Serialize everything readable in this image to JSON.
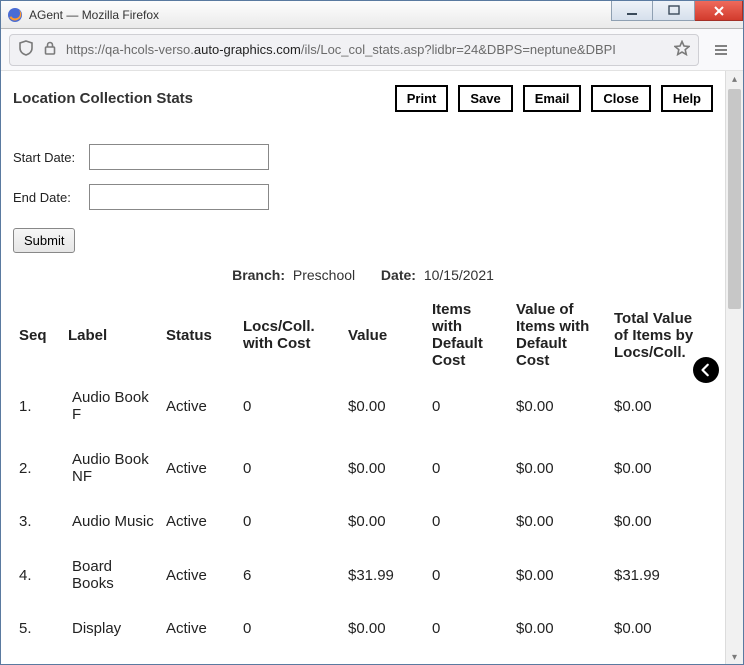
{
  "window": {
    "title": "AGent — Mozilla Firefox"
  },
  "url": {
    "prefix": "https://qa-hcols-verso.",
    "host": "auto-graphics.com",
    "suffix": "/ils/Loc_col_stats.asp?lidbr=24&DBPS=neptune&DBPI"
  },
  "page": {
    "title": "Location Collection Stats",
    "actions": {
      "print": "Print",
      "save": "Save",
      "email": "Email",
      "close": "Close",
      "help": "Help"
    },
    "form": {
      "start_label": "Start Date:",
      "end_label": "End Date:",
      "start_value": "",
      "end_value": "",
      "submit_label": "Submit"
    },
    "meta": {
      "branch_label": "Branch:",
      "branch_value": "Preschool",
      "date_label": "Date:",
      "date_value": "10/15/2021"
    },
    "table": {
      "headers": {
        "seq": "Seq",
        "label": "Label",
        "status": "Status",
        "locs": "Locs/Coll. with Cost",
        "value": "Value",
        "items": "Items with Default Cost",
        "valitems": "Value of Items with Default Cost",
        "total": "Total Value of Items by Locs/Coll."
      },
      "rows": [
        {
          "seq": "1.",
          "label": "Audio Book F",
          "status": "Active",
          "locs": "0",
          "value": "$0.00",
          "items": "0",
          "valitems": "$0.00",
          "total": "$0.00"
        },
        {
          "seq": "2.",
          "label": "Audio Book NF",
          "status": "Active",
          "locs": "0",
          "value": "$0.00",
          "items": "0",
          "valitems": "$0.00",
          "total": "$0.00"
        },
        {
          "seq": "3.",
          "label": "Audio Music",
          "status": "Active",
          "locs": "0",
          "value": "$0.00",
          "items": "0",
          "valitems": "$0.00",
          "total": "$0.00"
        },
        {
          "seq": "4.",
          "label": "Board Books",
          "status": "Active",
          "locs": "6",
          "value": "$31.99",
          "items": "0",
          "valitems": "$0.00",
          "total": "$31.99"
        },
        {
          "seq": "5.",
          "label": "Display",
          "status": "Active",
          "locs": "0",
          "value": "$0.00",
          "items": "0",
          "valitems": "$0.00",
          "total": "$0.00"
        }
      ]
    }
  }
}
